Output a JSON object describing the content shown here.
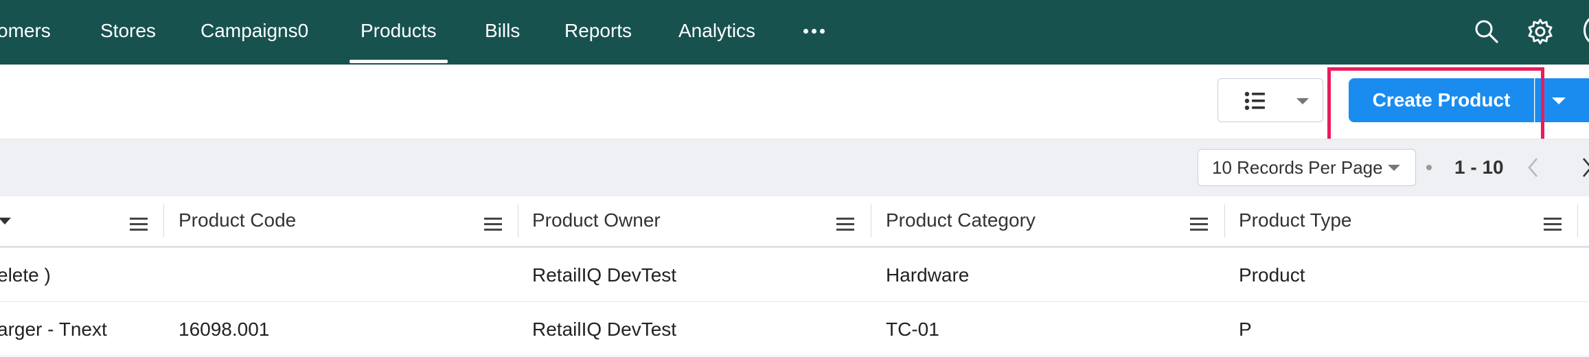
{
  "nav": {
    "items": [
      {
        "label": "omers",
        "active": false
      },
      {
        "label": "Stores",
        "active": false
      },
      {
        "label": "Campaigns0",
        "active": false
      },
      {
        "label": "Products",
        "active": true
      },
      {
        "label": "Bills",
        "active": false
      },
      {
        "label": "Reports",
        "active": false
      },
      {
        "label": "Analytics",
        "active": false
      }
    ],
    "more_icon": "more-dots-icon",
    "search_icon": "search-icon",
    "settings_icon": "gear-icon"
  },
  "toolbar": {
    "view_icon": "list-view-icon",
    "create_label": "Create Product"
  },
  "pager": {
    "per_page": "10 Records Per Page",
    "range": "1 - 10"
  },
  "table": {
    "columns": [
      "",
      "Product Code",
      "Product Owner",
      "Product Category",
      "Product Type"
    ],
    "rows": [
      [
        "elete )",
        "",
        "RetailIQ DevTest",
        "Hardware",
        "Product"
      ],
      [
        "arger - Tnext",
        "16098.001",
        "RetailIQ DevTest",
        "TC-01",
        "P"
      ]
    ]
  },
  "colors": {
    "nav_bg": "#17524f",
    "primary": "#1a8cf0",
    "highlight": "#ea1c5c"
  }
}
